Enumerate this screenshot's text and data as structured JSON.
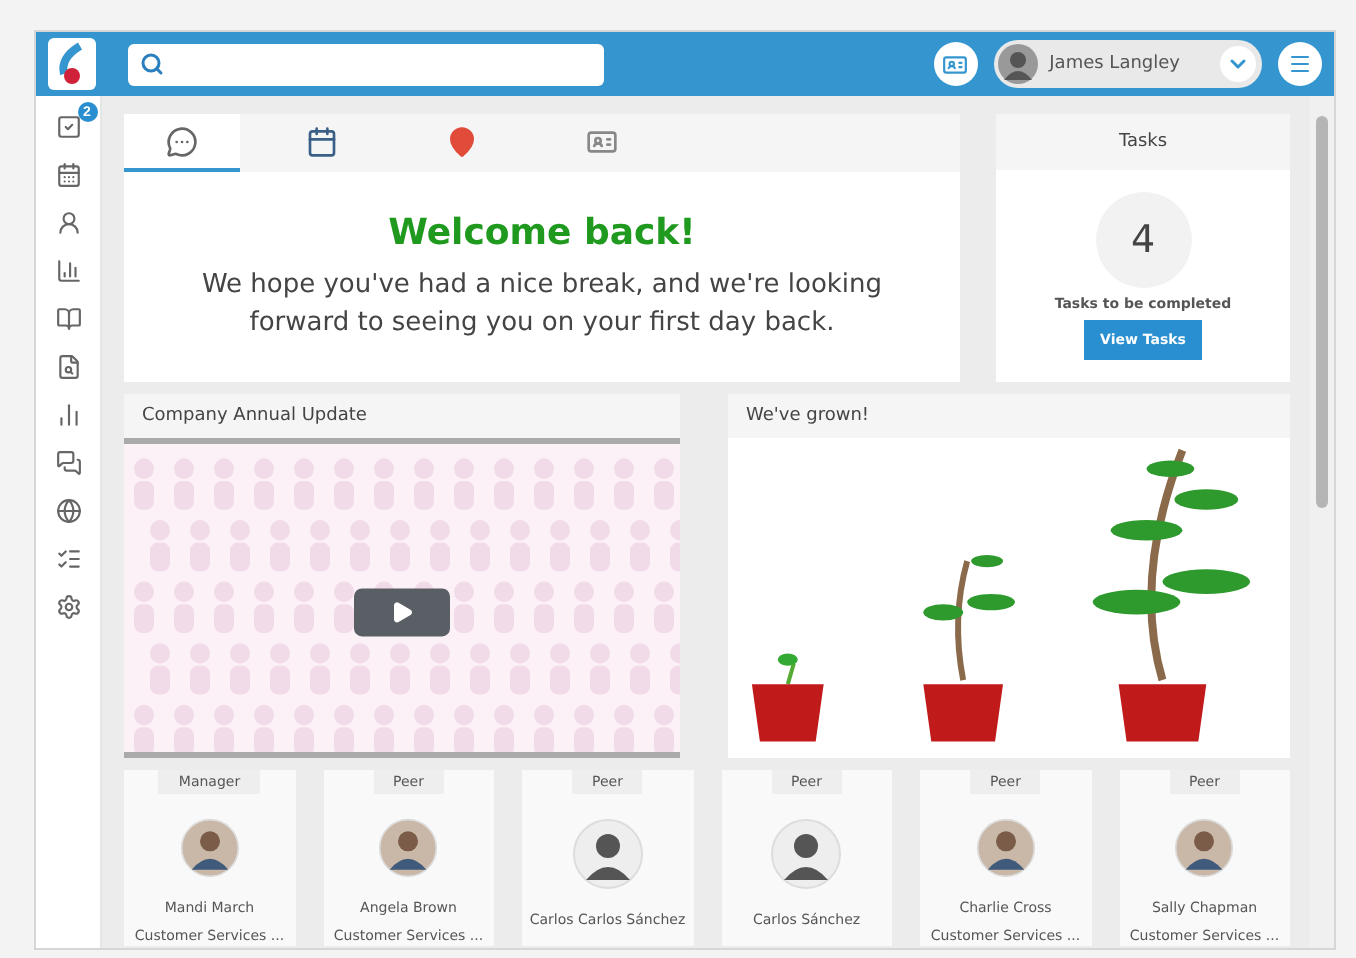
{
  "header": {
    "user": {
      "name": "James Langley"
    }
  },
  "sidebar": {
    "badge": "2"
  },
  "welcome": {
    "tabs": [
      {
        "kind": "chat",
        "selected": true
      },
      {
        "kind": "calendar",
        "selected": false
      },
      {
        "kind": "location",
        "selected": false
      },
      {
        "kind": "card",
        "selected": false
      }
    ],
    "title": "Welcome back!",
    "message": "We hope you've had a nice break, and we're looking forward to seeing you on your first day back."
  },
  "tasks": {
    "title": "Tasks",
    "count": "4",
    "caption": "Tasks to be completed",
    "button": "View Tasks"
  },
  "video": {
    "title": "Company Annual Update"
  },
  "growth": {
    "title": "We've grown!"
  },
  "people": [
    {
      "role": "Manager",
      "name": "Mandi March",
      "job": "Customer Services ..."
    },
    {
      "role": "Peer",
      "name": "Angela Brown",
      "job": "Customer Services ..."
    },
    {
      "role": "Peer",
      "name": "Carlos Carlos Sánchez",
      "kind": "placeholder"
    },
    {
      "role": "Peer",
      "name": "Carlos Sánchez",
      "kind": "placeholder"
    },
    {
      "role": "Peer",
      "name": "Charlie Cross",
      "job": "Customer Services ..."
    },
    {
      "role": "Peer",
      "name": "Sally Chapman",
      "job": "Customer Services ..."
    }
  ]
}
